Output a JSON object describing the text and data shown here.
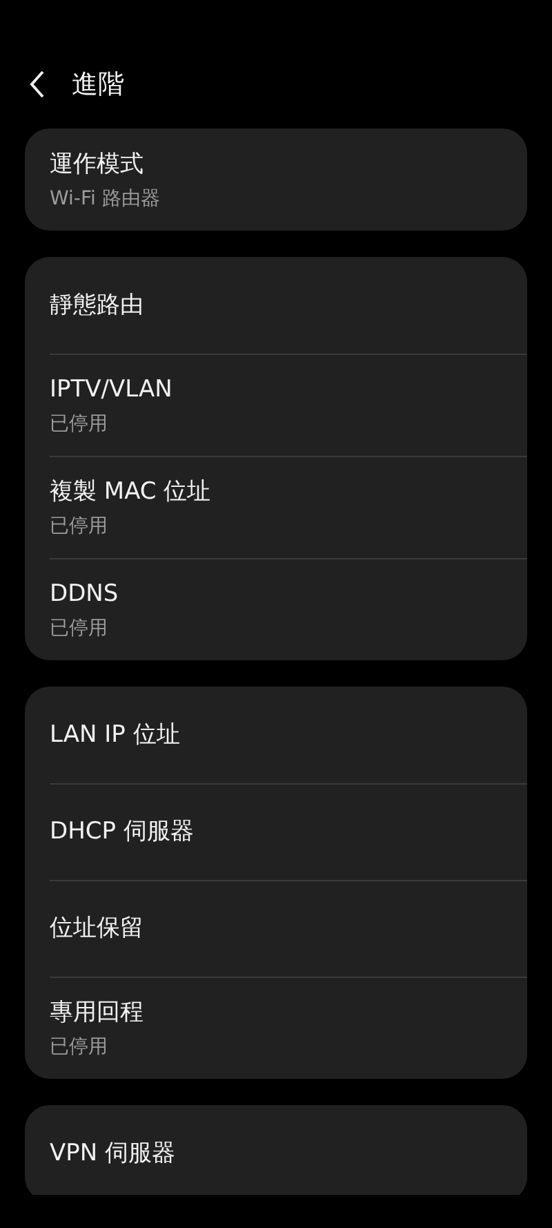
{
  "header": {
    "title": "進階"
  },
  "sections": [
    {
      "items": [
        {
          "title": "運作模式",
          "subtitle": "Wi-Fi 路由器"
        }
      ]
    },
    {
      "items": [
        {
          "title": "靜態路由"
        },
        {
          "title": "IPTV/VLAN",
          "subtitle": "已停用"
        },
        {
          "title": "複製 MAC 位址",
          "subtitle": "已停用"
        },
        {
          "title": "DDNS",
          "subtitle": "已停用"
        }
      ]
    },
    {
      "items": [
        {
          "title": "LAN IP 位址"
        },
        {
          "title": "DHCP 伺服器"
        },
        {
          "title": "位址保留"
        },
        {
          "title": "專用回程",
          "subtitle": "已停用"
        }
      ]
    },
    {
      "items": [
        {
          "title": "VPN 伺服器"
        }
      ]
    }
  ]
}
